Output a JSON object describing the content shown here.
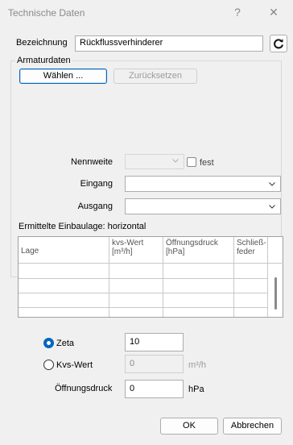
{
  "window": {
    "title": "Technische Daten",
    "help": "?",
    "close": "✕"
  },
  "bezeichnung": {
    "label": "Bezeichnung",
    "value": "Rückflussverhinderer"
  },
  "armatur": {
    "group_title": "Armaturdaten",
    "waehlen_label": "Wählen ...",
    "zuruecksetzen_label": "Zurücksetzen",
    "nennweite_label": "Nennweite",
    "nennweite_value": "",
    "fest_label": "fest",
    "eingang_label": "Eingang",
    "eingang_value": "",
    "ausgang_label": "Ausgang",
    "ausgang_value": ""
  },
  "einbaulage": "Ermittelte Einbaulage: horizontal",
  "table": {
    "headers": [
      "Lage",
      "kvs-Wert\n[m³/h]",
      "Öffnungsdruck\n[hPa]",
      "Schließ-\nfeder"
    ],
    "rows": [
      [
        "",
        "",
        "",
        ""
      ],
      [
        "",
        "",
        "",
        ""
      ],
      [
        "",
        "",
        "",
        ""
      ],
      [
        "",
        "",
        "",
        ""
      ]
    ]
  },
  "zeta": {
    "label": "Zeta",
    "value": "10",
    "checked": true
  },
  "kvs": {
    "label": "Kvs-Wert",
    "value": "0",
    "unit": "m³/h",
    "checked": false
  },
  "oeffnungsdruck": {
    "label": "Öffnungsdruck",
    "value": "0",
    "unit": "hPa"
  },
  "ok_label": "OK",
  "abbrechen_label": "Abbrechen"
}
